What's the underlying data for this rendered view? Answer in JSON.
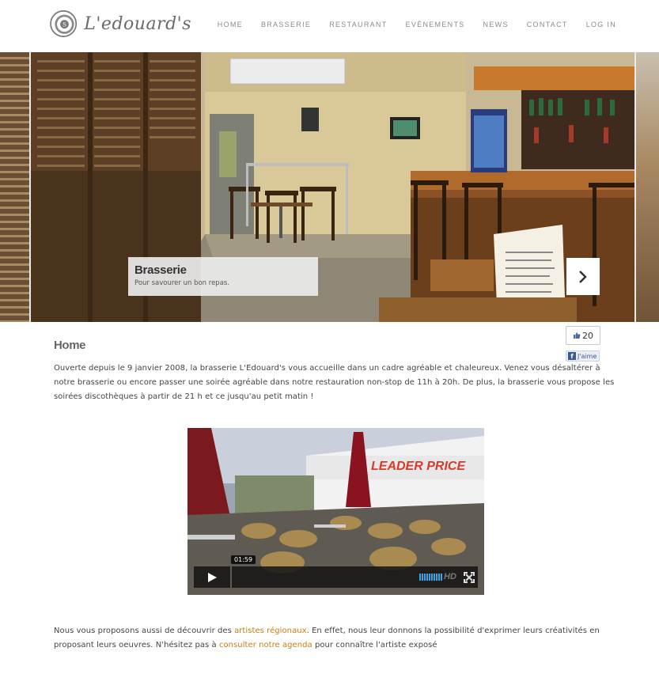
{
  "header": {
    "logo_text": "L'edouard's",
    "nav": [
      "HOME",
      "BRASSERIE",
      "RESTAURANT",
      "EVÈNEMENTS",
      "NEWS",
      "CONTACT",
      "LOG IN"
    ]
  },
  "slider": {
    "caption_title": "Brasserie",
    "caption_subtitle": "Pour savourer un bon repas.",
    "next_icon": "chevron-right-icon"
  },
  "social": {
    "like_count": "20",
    "like_label": "J'aime"
  },
  "main": {
    "title": "Home",
    "paragraph1": "Ouverte depuis le 9 janvier 2008, la brasserie L'Edouard's vous accueille dans un cadre agréable et chaleureux. Venez vous désaltérer à notre brasserie ou encore passer une soirée agréable dans notre restauration non-stop de 11h à 20h. De plus, la brasserie vous propose les soirées discothèques à partir de 21 h et ce jusqu'au petit matin !",
    "paragraph2_pre": "Nous vous proposons aussi de découvrir des ",
    "paragraph2_link1": "artistes régionaux",
    "paragraph2_mid": ". En effet, nous leur donnons la possibilité d'exprimer leurs créativités en proposant leurs oeuvres. N'hésitez pas à ",
    "paragraph2_link2": "consulter notre agenda",
    "paragraph2_post": " pour connaître l'artiste exposé"
  },
  "video": {
    "time": "01:59",
    "hd_label": "HD",
    "sign_text": "LEADER PRICE"
  },
  "colors": {
    "link": "#c97d12",
    "volume": "#36a6e8",
    "facebook": "#3b5998"
  }
}
